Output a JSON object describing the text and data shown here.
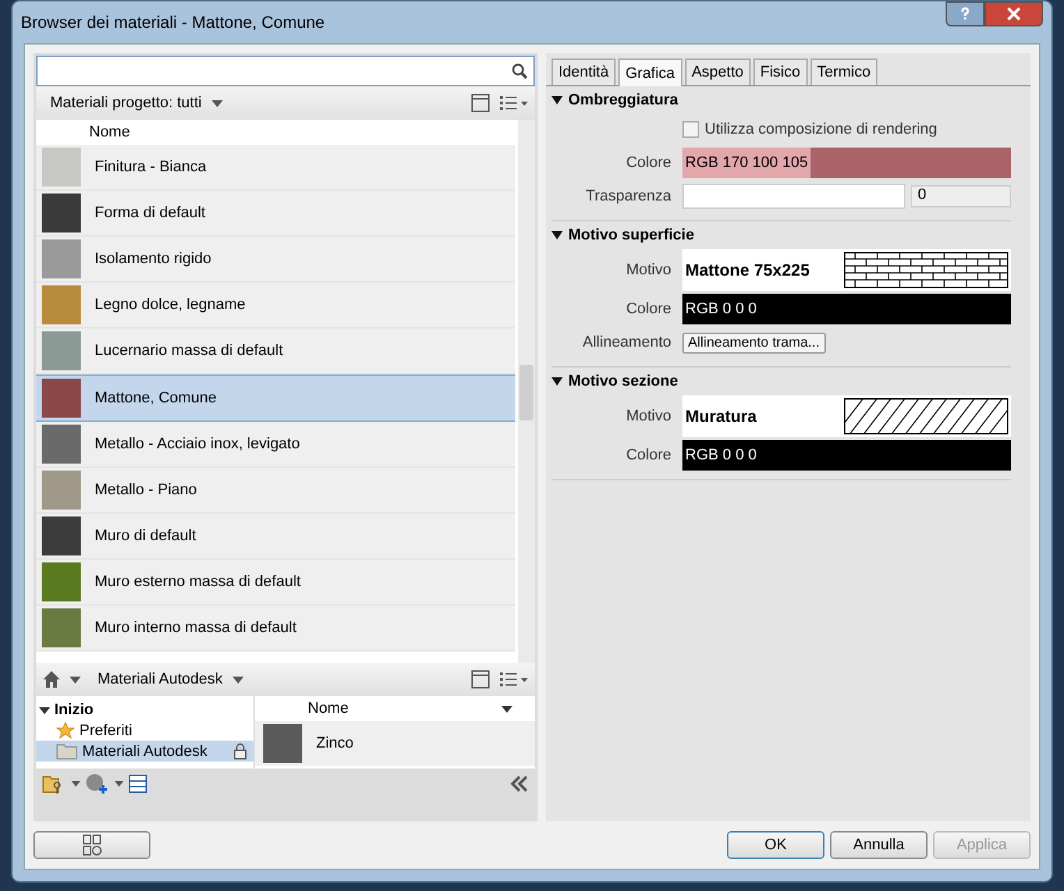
{
  "window": {
    "title": "Browser dei materiali - Mattone, Comune"
  },
  "project_filter": {
    "label": "Materiali progetto: tutti"
  },
  "materials": {
    "column": "Nome",
    "items": [
      {
        "name": "Finitura - Bianca",
        "color": "#c8c8c4",
        "selected": false
      },
      {
        "name": "Forma di default",
        "color": "#3a3a3a",
        "selected": false
      },
      {
        "name": "Isolamento rigido",
        "color": "#9a9a9a",
        "selected": false
      },
      {
        "name": "Legno dolce, legname",
        "color": "#b88a3c",
        "selected": false
      },
      {
        "name": "Lucernario massa di default",
        "color": "#8c9a96",
        "selected": false
      },
      {
        "name": "Mattone, Comune",
        "color": "#8a4848",
        "selected": true
      },
      {
        "name": "Metallo - Acciaio inox, levigato",
        "color": "#6a6a6a",
        "selected": false
      },
      {
        "name": "Metallo - Piano",
        "color": "#a09888",
        "selected": false
      },
      {
        "name": "Muro di default",
        "color": "#3c3c3c",
        "selected": false
      },
      {
        "name": "Muro esterno massa di default",
        "color": "#5a7a20",
        "selected": false
      },
      {
        "name": "Muro interno massa di default",
        "color": "#6a7a40",
        "selected": false
      }
    ]
  },
  "library": {
    "breadcrumb": "Materiali Autodesk",
    "tree": [
      {
        "label": "Inizio",
        "expanded": true,
        "selected": false,
        "children": [
          {
            "label": "Preferiti",
            "kind": "star",
            "selected": false
          },
          {
            "label": "Materiali Autodesk",
            "kind": "folder",
            "selected": true
          }
        ]
      }
    ],
    "column": "Nome",
    "items": [
      {
        "name": "Zinco",
        "color": "#5a5a5a"
      }
    ]
  },
  "tabs": [
    {
      "label": "Identità",
      "selected": false
    },
    {
      "label": "Grafica",
      "selected": true
    },
    {
      "label": "Aspetto",
      "selected": false
    },
    {
      "label": "Fisico",
      "selected": false
    },
    {
      "label": "Termico",
      "selected": false
    }
  ],
  "sections": [
    {
      "title": "Ombreggiatura",
      "expanded": true,
      "rows": [
        {
          "kind": "checkbox",
          "text": "Utilizza composizione di rendering",
          "checked": false
        },
        {
          "kind": "color",
          "label": "Colore",
          "value": "RGB 170 100 105",
          "color": "#aa6469"
        },
        {
          "kind": "slider",
          "label": "Trasparenza",
          "reading": "0"
        }
      ]
    },
    {
      "title": "Motivo superficie",
      "expanded": true,
      "rows": [
        {
          "kind": "brick",
          "label": "Motivo",
          "value": "Mattone 75x225"
        },
        {
          "kind": "color",
          "label": "Colore",
          "value": "RGB 0 0 0",
          "color": "#000000"
        },
        {
          "kind": "button",
          "label": "Allineamento",
          "value": "Allineamento trama..."
        }
      ]
    },
    {
      "title": "Motivo sezione",
      "expanded": true,
      "rows": [
        {
          "kind": "hatch",
          "label": "Motivo",
          "value": "Muratura"
        },
        {
          "kind": "color",
          "label": "Colore",
          "value": "RGB 0 0 0",
          "color": "#000000"
        }
      ]
    }
  ],
  "buttons": [
    {
      "label": "OK",
      "disabled": false,
      "default": true
    },
    {
      "label": "Annulla",
      "disabled": false,
      "default": false
    },
    {
      "label": "Applica",
      "disabled": true,
      "default": false
    }
  ]
}
